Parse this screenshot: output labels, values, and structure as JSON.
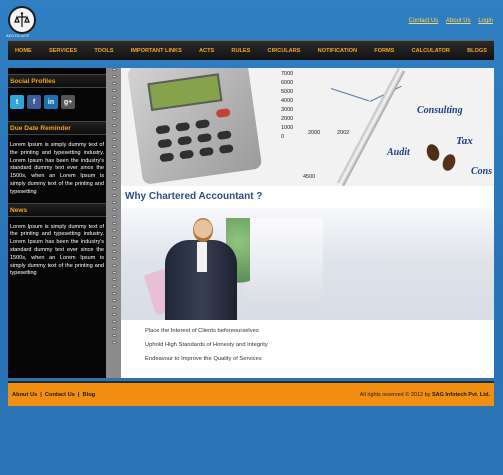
{
  "header": {
    "logo_text": "ADVOCATE",
    "top_links": [
      "Contact Us",
      "About Us",
      "Login"
    ]
  },
  "nav": {
    "items": [
      "HOME",
      "SERVICES",
      "TOOLS",
      "IMPORTANT LINKS",
      "ACTS",
      "RULES",
      "CIRCULARS",
      "NOTIFICATION",
      "FORMS",
      "CALCULATOR",
      "BLOGS"
    ]
  },
  "sidebar": {
    "social_title": "Social Profiles",
    "social_icons": [
      "twitter-icon",
      "facebook-icon",
      "linkedin-icon",
      "googleplus-icon"
    ],
    "due_title": "Due Date Reminder",
    "due_text": "Lorem Ipsum is simply dummy text of the printing and typesetting industry. Lorem Ipsum has been the industry's standard dummy text ever since the 1500s, when an Lorem Ipsum is simply dummy text of the printing and typesetting",
    "news_title": "News",
    "news_text": "Lorem Ipsum is simply dummy text of the printing and typesetting industry. Lorem Ipsum has been the industry's standard dummy text ever since the 1500s, when an Lorem Ipsum is simply dummy text of the printing and typesetting"
  },
  "banner": {
    "numbers": [
      "7000",
      "6000",
      "5000",
      "4000",
      "3000",
      "2000",
      "1000",
      "0"
    ],
    "x_labels": [
      "2000",
      "2002"
    ],
    "bottom_number": "4500",
    "words": [
      "Consulting",
      "Audit",
      "Tax",
      "Cons"
    ]
  },
  "main": {
    "title": "Why Chartered Accountant ?",
    "bullets": [
      "Place the Interest of Clients beforeourselves",
      "Uphold High Standards of Honesty and Integrity",
      "Endeavour to Improve the Quality of Services"
    ]
  },
  "footer": {
    "links": [
      "About Us",
      "Contact Us",
      "Blog"
    ],
    "copyright": "All rights reserved © 2012 by",
    "company": "SAG Infotech Pvt. Ltd."
  }
}
